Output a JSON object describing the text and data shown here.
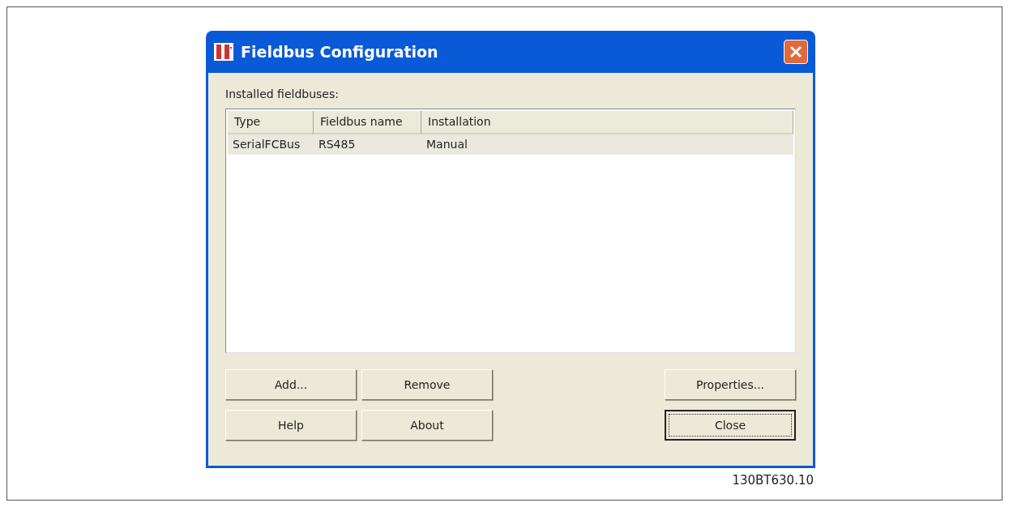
{
  "window": {
    "title": "Fieldbus Configuration"
  },
  "list_label": "Installed fieldbuses:",
  "table": {
    "columns": [
      "Type",
      "Fieldbus name",
      "Installation"
    ],
    "rows": [
      {
        "cells": [
          "SerialFCBus",
          "RS485",
          "Manual"
        ],
        "selected": true
      }
    ]
  },
  "buttons": [
    {
      "label": "Add...",
      "default": false
    },
    {
      "label": "Remove",
      "default": false
    },
    {
      "label": "Properties...",
      "default": false
    },
    {
      "label": "Help",
      "default": false
    },
    {
      "label": "About",
      "default": false
    },
    {
      "label": "Close",
      "default": true
    }
  ],
  "figure_id": "130BT630.10"
}
